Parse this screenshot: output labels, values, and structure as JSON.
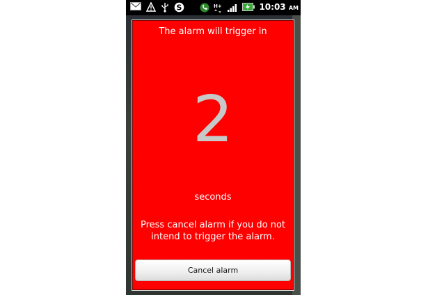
{
  "status_bar": {
    "left_icons": [
      "mail-icon",
      "warning-icon",
      "usb-icon",
      "skype-icon"
    ],
    "right_icons": [
      "phone-call-icon",
      "hplus-data-icon",
      "signal-icon",
      "battery-icon"
    ],
    "network_type": "H+",
    "time": "10:03",
    "ampm": "AM"
  },
  "dialog": {
    "title": "The alarm will trigger in",
    "countdown": "2",
    "unit": "seconds",
    "message_line1": "Press cancel alarm if you do not",
    "message_line2": "intend to trigger the alarm.",
    "cancel_label": "Cancel alarm",
    "background_color": "#ff0000"
  }
}
